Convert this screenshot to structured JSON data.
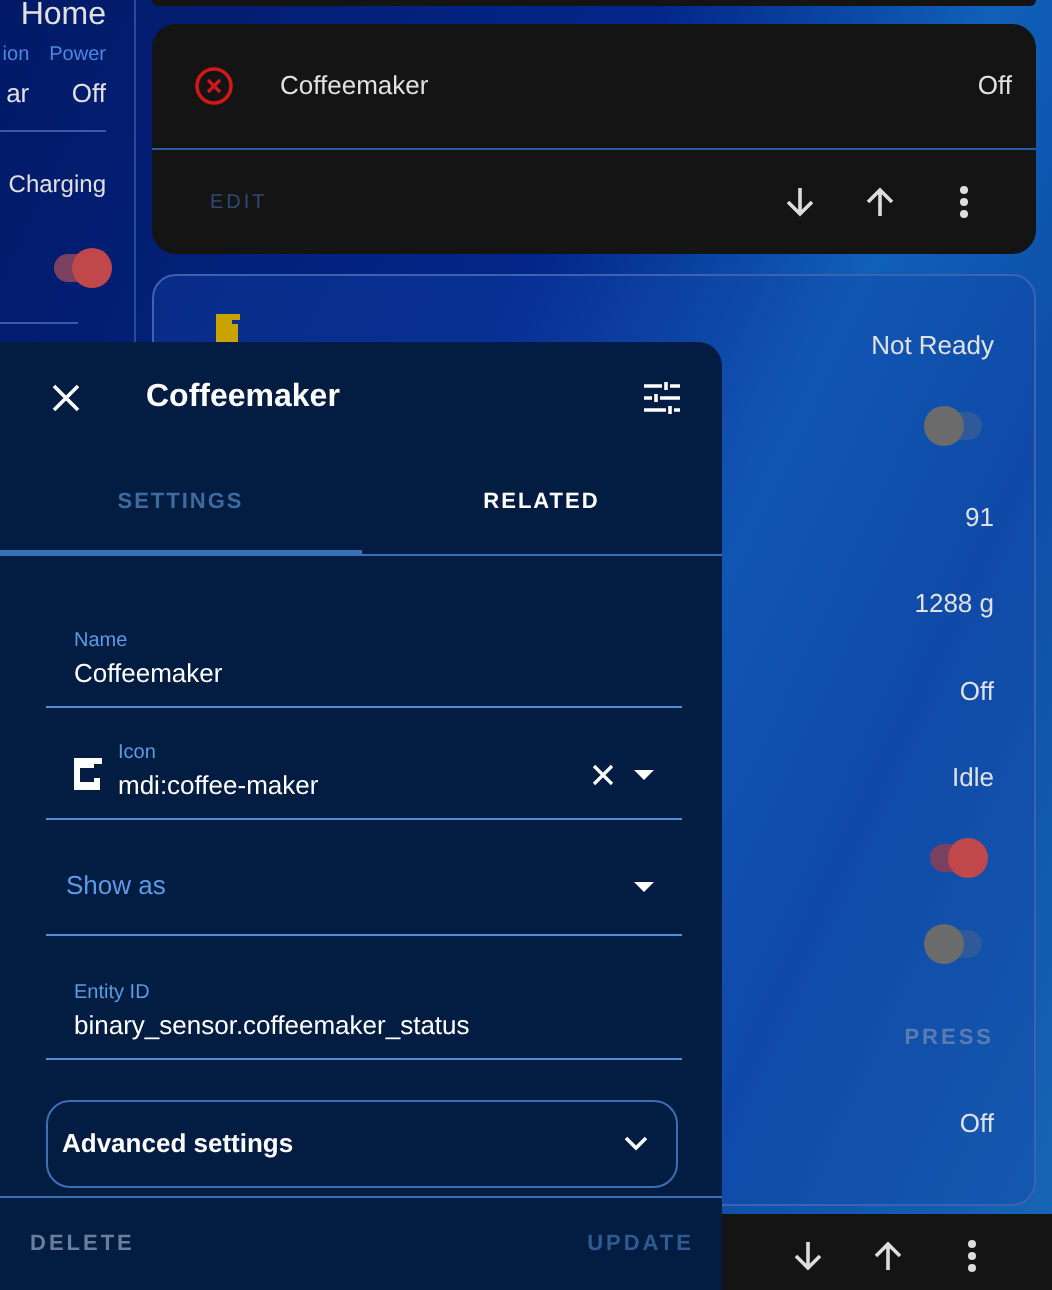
{
  "side_strip": {
    "title": "Home",
    "stats": [
      {
        "label": "ion",
        "value": "ar"
      },
      {
        "label": "Power",
        "value": "Off"
      }
    ],
    "charging": {
      "label": "Charging",
      "on": true
    }
  },
  "entity_card": {
    "name": "Coffeemaker",
    "state": "Off",
    "edit": "EDIT"
  },
  "machine_card": {
    "rows": [
      {
        "kind": "text",
        "value": "Not Ready"
      },
      {
        "kind": "toggle",
        "on": false
      },
      {
        "kind": "text",
        "value": "91"
      },
      {
        "kind": "text",
        "value": "1288 g"
      },
      {
        "kind": "text",
        "value": "Off"
      },
      {
        "kind": "text",
        "value": "Idle"
      },
      {
        "kind": "toggle",
        "on": true
      },
      {
        "kind": "toggle",
        "on": false
      },
      {
        "kind": "button",
        "value": "PRESS"
      },
      {
        "kind": "text",
        "value": "Off"
      }
    ]
  },
  "dialog": {
    "title": "Coffeemaker",
    "tabs": [
      {
        "label": "SETTINGS",
        "selected": false,
        "underlined": true
      },
      {
        "label": "RELATED",
        "selected": true,
        "underlined": false
      }
    ],
    "fields": [
      {
        "kind": "text",
        "label": "Name",
        "value": "Coffeemaker"
      },
      {
        "kind": "icon",
        "label": "Icon",
        "value": "mdi:coffee-maker"
      },
      {
        "kind": "select",
        "placeholder": "Show as"
      },
      {
        "kind": "text",
        "label": "Entity ID",
        "value": "binary_sensor.coffeemaker_status"
      }
    ],
    "advanced": {
      "label": "Advanced settings",
      "expanded": false
    },
    "delete": "DELETE",
    "update": "UPDATE"
  }
}
